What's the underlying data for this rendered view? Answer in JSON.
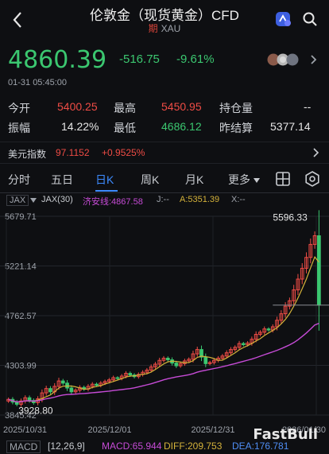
{
  "header": {
    "title": "伦敦金（现货黄金）CFD",
    "badge": "期",
    "symbol": "XAU"
  },
  "quote": {
    "price": "4860.39",
    "change": "-516.75",
    "change_pct": "-9.61%",
    "datetime": "01-31 05:45:00"
  },
  "stats": {
    "open_label": "今开",
    "open": "5400.25",
    "high_label": "最高",
    "high": "5450.95",
    "oi_label": "持仓量",
    "oi": "--",
    "amp_label": "振幅",
    "amp": "14.22%",
    "low_label": "最低",
    "low": "4686.12",
    "settle_label": "昨结算",
    "settle": "5377.14"
  },
  "dollar_index": {
    "label": "美元指数",
    "value": "97.1152",
    "change": "+0.9525%"
  },
  "tabs": [
    "分时",
    "五日",
    "日K",
    "周K",
    "月K",
    "更多"
  ],
  "active_tab": "日K",
  "indicator": {
    "selector": "JAX",
    "name": "JAX(30)",
    "line_label": "济安线:4867.58",
    "j": "J:--",
    "a": "A:5351.39",
    "x": "X:--"
  },
  "chart_data": {
    "type": "candlestick",
    "y_ticks": [
      "5679.71",
      "5221.14",
      "4762.57",
      "4303.99",
      "3845.42"
    ],
    "x_ticks": [
      "2025/10/31",
      "2025/12/01",
      "2025/12/31",
      "2026/01/30"
    ],
    "high_label": "5596.33",
    "low_label": "3928.80",
    "colors": {
      "up": "#ef4c45",
      "down": "#3bc770",
      "ma_fast": "#d4b23a",
      "ma_slow": "#c64bd6"
    },
    "closes": [
      3990,
      3965,
      3945,
      3975,
      4005,
      3980,
      3960,
      3995,
      4050,
      4090,
      4060,
      4110,
      4160,
      4140,
      4095,
      4060,
      4075,
      4100,
      4085,
      4110,
      4130,
      4120,
      4140,
      4155,
      4170,
      4190,
      4185,
      4205,
      4230,
      4215,
      4200,
      4220,
      4240,
      4260,
      4290,
      4315,
      4350,
      4370,
      4355,
      4325,
      4300,
      4320,
      4345,
      4360,
      4410,
      4450,
      4380,
      4320,
      4330,
      4350,
      4370,
      4390,
      4420,
      4450,
      4470,
      4505,
      4495,
      4510,
      4545,
      4590,
      4610,
      4640,
      4630,
      4660,
      4720,
      4780,
      4850,
      4900,
      5000,
      5100,
      5200,
      5300,
      5420,
      5500,
      4860
    ]
  },
  "macd": {
    "selector": "MACD",
    "params": "[12,26,9]",
    "macd": "MACD:65.944",
    "diff": "DIFF:209.753",
    "dea": "DEA:176.781"
  },
  "watermark": "FastBull"
}
